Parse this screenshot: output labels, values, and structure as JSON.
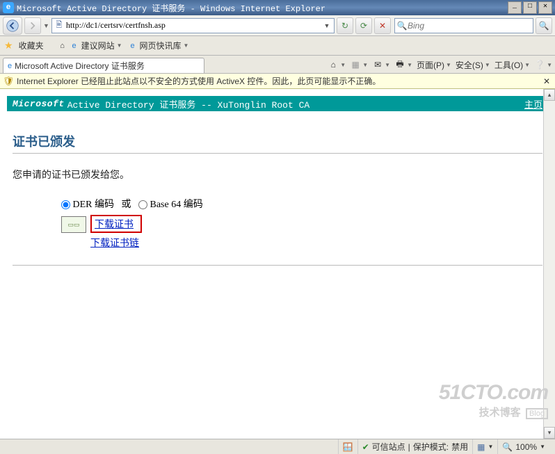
{
  "window": {
    "title": "Microsoft Active Directory 证书服务 - Windows Internet Explorer"
  },
  "nav": {
    "url": "http://dc1/certsrv/certfnsh.asp",
    "search_placeholder": "Bing"
  },
  "favorites": {
    "label": "收藏夹",
    "items": [
      {
        "label": "建议网站",
        "icon": "e"
      },
      {
        "label": "网页快讯库",
        "icon": "e"
      }
    ]
  },
  "tab": {
    "title": "Microsoft Active Directory 证书服务"
  },
  "commandbar": {
    "page": "页面(P)",
    "safety": "安全(S)",
    "tools": "工具(O)"
  },
  "infobar": {
    "text": "Internet Explorer 已经阻止此站点以不安全的方式使用 ActiveX 控件。因此，此页可能显示不正确。"
  },
  "cert": {
    "banner_product": "Microsoft",
    "banner_rest": " Active Directory 证书服务  --  XuTonglin Root CA",
    "home": "主页",
    "heading": "证书已颁发",
    "message": "您申请的证书已颁发给您。",
    "enc_der": "DER 编码",
    "enc_or": "或",
    "enc_b64": "Base 64 编码",
    "link_download_cert": "下载证书",
    "link_download_chain": "下载证书链"
  },
  "status": {
    "trusted": "可信站点",
    "protected_label": "保护模式:",
    "protected_value": "禁用",
    "zoom": "100%"
  },
  "watermark": {
    "big": "51CTO.com",
    "small": "技术博客",
    "blog": "Blog"
  }
}
